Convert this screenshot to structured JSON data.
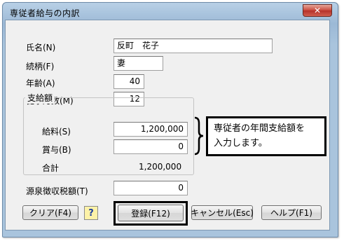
{
  "window": {
    "title": "専従者給与の内訳",
    "close_glyph": "✕"
  },
  "form": {
    "name": {
      "label": "氏名(N)",
      "value": "反町　花子"
    },
    "relation": {
      "label": "続柄(F)",
      "value": "妻"
    },
    "age": {
      "label": "年齢(A)",
      "value": "40"
    },
    "months": {
      "label": "従事月数(M)",
      "value": "12"
    },
    "pay_group": {
      "legend": "支給額",
      "salary": {
        "label": "給料(S)",
        "value": "1,200,000"
      },
      "bonus": {
        "label": "賞与(B)",
        "value": "0"
      },
      "total": {
        "label": "合計",
        "value": "1,200,000"
      }
    },
    "withholding": {
      "label": "源泉徴収税額(T)",
      "value": "0"
    }
  },
  "buttons": {
    "clear": "クリア(F4)",
    "help_icon": "?",
    "register": "登録(F12)",
    "cancel": "キャンセル(Esc)",
    "help": "ヘルプ(F1)"
  },
  "annotation": {
    "line1": "専従者の年間支給額を",
    "line2": "入力します。"
  },
  "colors": {
    "titlebar": "#a9c4dd",
    "client_bg": "#f0f0f0",
    "close_button": "#c9483a",
    "annotation_border": "#000000"
  }
}
